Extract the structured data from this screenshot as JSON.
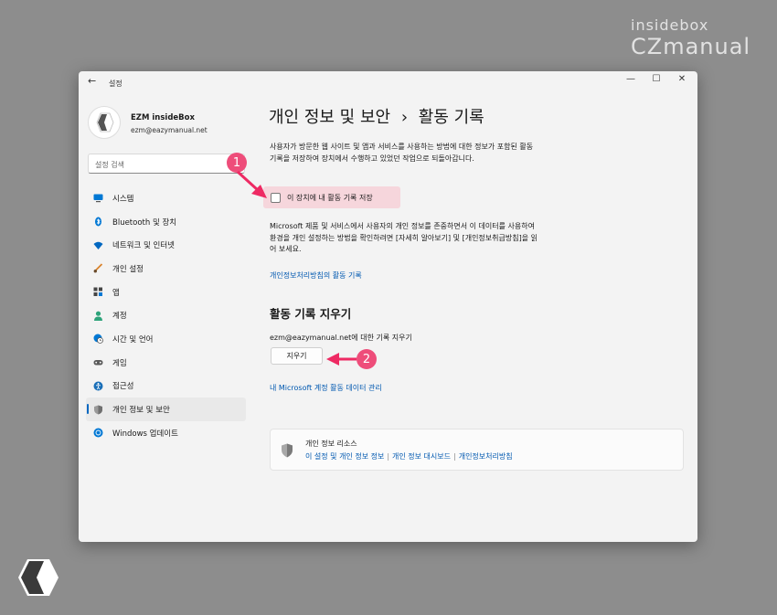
{
  "watermark": {
    "top": "insidebox",
    "main": "CZmanual"
  },
  "window": {
    "title": "설정",
    "controls": {
      "minimize": "—",
      "maximize": "☐",
      "close": "✕"
    }
  },
  "profile": {
    "name": "EZM insideBox",
    "email": "ezm@eazymanual.net"
  },
  "search": {
    "placeholder": "설정 검색"
  },
  "sidebar": {
    "items": [
      {
        "label": "시스템",
        "icon": "monitor-icon",
        "color": "#0078d4"
      },
      {
        "label": "Bluetooth 및 장치",
        "icon": "bluetooth-icon",
        "color": "#0078d4"
      },
      {
        "label": "네트워크 및 인터넷",
        "icon": "wifi-icon",
        "color": "#0067c0"
      },
      {
        "label": "개인 설정",
        "icon": "brush-icon",
        "color": "#d9822b"
      },
      {
        "label": "앱",
        "icon": "apps-icon",
        "color": "#444444"
      },
      {
        "label": "계정",
        "icon": "person-icon",
        "color": "#2ea37a"
      },
      {
        "label": "시간 및 언어",
        "icon": "globe-clock-icon",
        "color": "#0078d4"
      },
      {
        "label": "게임",
        "icon": "gamepad-icon",
        "color": "#5a5a5a"
      },
      {
        "label": "접근성",
        "icon": "accessibility-icon",
        "color": "#1a6fb8"
      },
      {
        "label": "개인 정보 및 보안",
        "icon": "shield-icon",
        "color": "#777777",
        "active": true
      },
      {
        "label": "Windows 업데이트",
        "icon": "update-icon",
        "color": "#0078d4"
      }
    ]
  },
  "main": {
    "breadcrumb_parent": "개인 정보 및 보안",
    "breadcrumb_sep": "›",
    "breadcrumb_current": "활동 기록",
    "description": "사용자가 방문한 웹 사이트 및 앱과 서비스를 사용하는 방법에 대한 정보가 포함된 활동 기록을 저장하여 장치에서 수행하고 있었던 작업으로 되돌아갑니다.",
    "checkbox_label": "이 장치에 내 활동 기록 저장",
    "checkbox_checked": false,
    "description2": "Microsoft 제품 및 서비스에서 사용자의 개인 정보를 존중하면서 이 데이터를 사용하여 환경을 개인 설정하는 방법을 확인하려면 [자세히 알아보기] 및 [개인정보취급방침]을 읽어 보세요.",
    "policy_link": "개인정보처리방침의 활동 기록",
    "clear_section_title": "활동 기록 지우기",
    "clear_text": "ezm@eazymanual.net에 대한 기록 지우기",
    "clear_button": "지우기",
    "manage_link": "내 Microsoft 계정 활동 데이터 관리",
    "resources": {
      "title": "개인 정보 리소스",
      "links": [
        "이 설정 및 개인 정보 정보",
        "개인 정보 대시보드",
        "개인정보처리방침"
      ],
      "separator": "|"
    }
  },
  "annotations": {
    "badge1": "1",
    "badge2": "2",
    "accent": "#ee4d7a"
  }
}
